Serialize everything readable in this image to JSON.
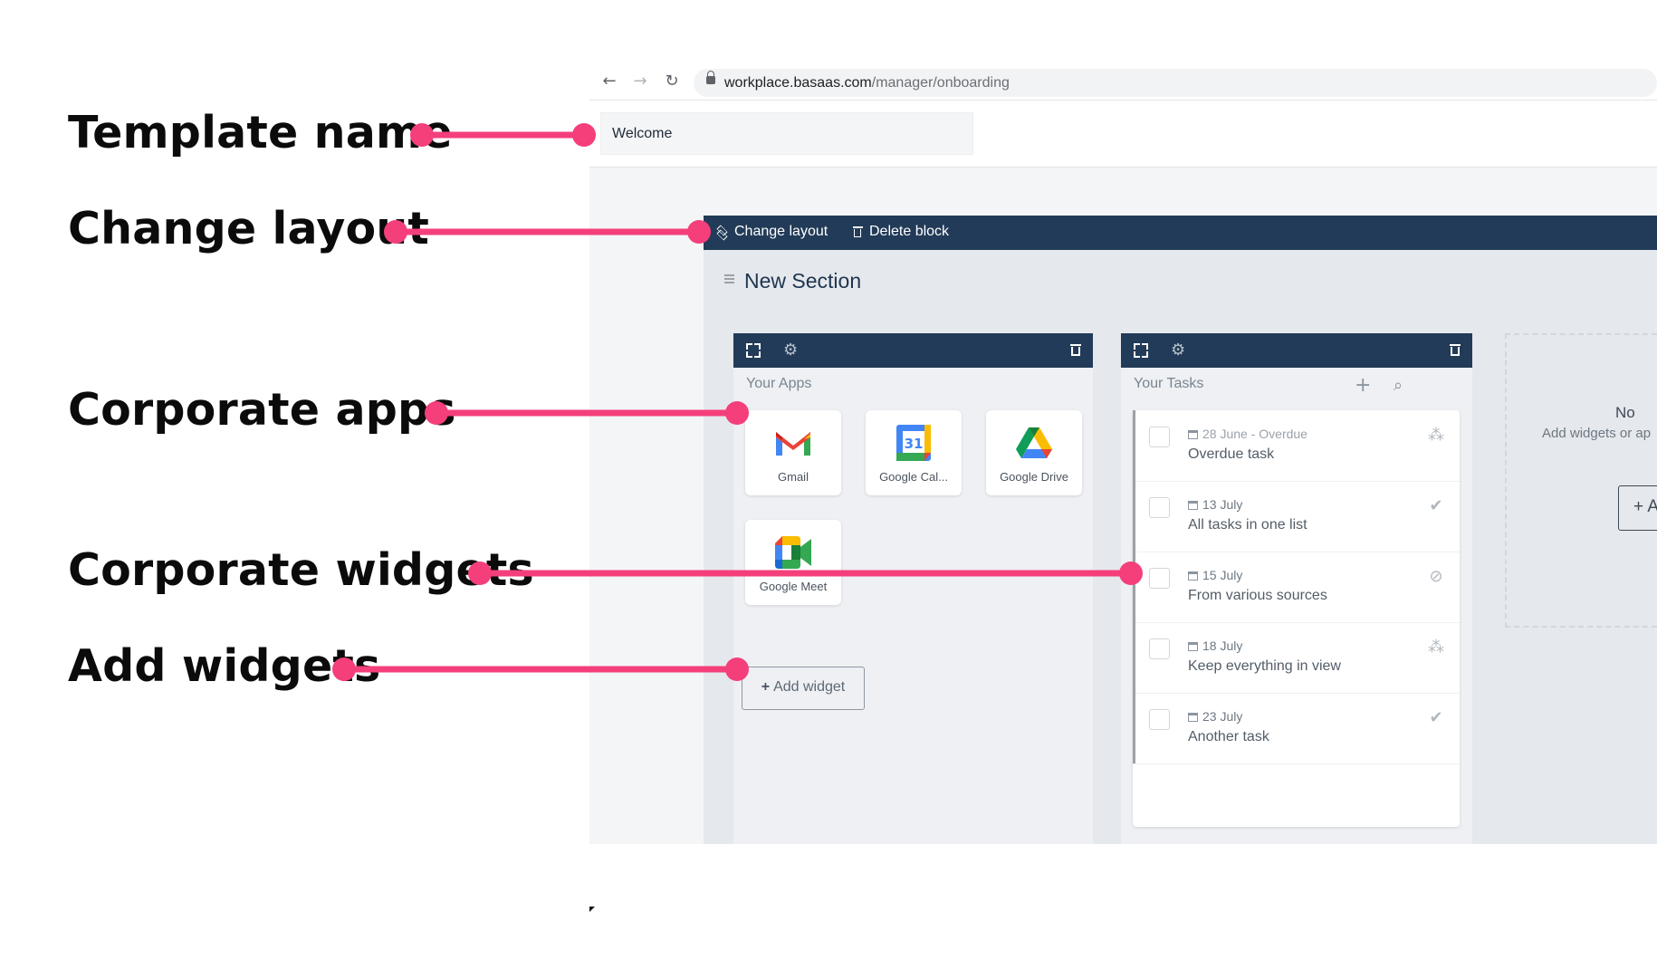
{
  "callouts": {
    "template_name": "Template name",
    "change_layout": "Change layout",
    "corporate_apps": "Corporate apps",
    "corporate_widgets": "Corporate widgets",
    "add_widgets": "Add widgets"
  },
  "browser": {
    "url_host": "workplace.basaas.com",
    "url_path": "/manager/onboarding"
  },
  "template": {
    "name": "Welcome"
  },
  "block_toolbar": {
    "change_layout": "Change layout",
    "delete_block": "Delete block"
  },
  "section": {
    "title": "New Section"
  },
  "apps_widget": {
    "caption": "Your Apps",
    "apps": [
      {
        "name": "Gmail"
      },
      {
        "name": "Google Cal..."
      },
      {
        "name": "Google Drive"
      },
      {
        "name": "Google Meet"
      }
    ],
    "add_widget_label": "Add widget"
  },
  "tasks_widget": {
    "caption": "Your Tasks",
    "tasks": [
      {
        "date": "28 June - Overdue",
        "title": "Overdue task"
      },
      {
        "date": "13 July",
        "title": "All tasks in one list"
      },
      {
        "date": "15 July",
        "title": "From various sources"
      },
      {
        "date": "18 July",
        "title": "Keep everything in view"
      },
      {
        "date": "23 July",
        "title": "Another task"
      }
    ]
  },
  "empty_column": {
    "title": "No",
    "subtitle": "Add widgets or ap",
    "button": "+ A"
  },
  "colors": {
    "accent": "#f43f7b",
    "toolbar": "#223b58",
    "canvas": "#e5e8ec"
  }
}
